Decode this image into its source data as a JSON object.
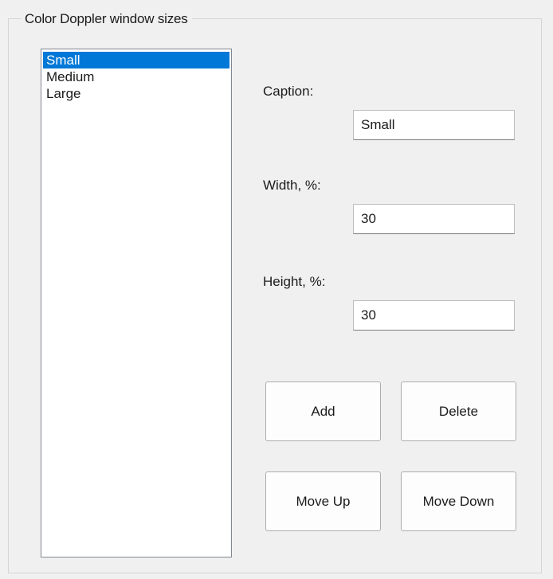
{
  "group": {
    "title": "Color Doppler window sizes"
  },
  "sizes_list": {
    "items": [
      "Small",
      "Medium",
      "Large"
    ],
    "selected_index": 0
  },
  "caption": {
    "label": "Caption:",
    "value": "Small"
  },
  "width": {
    "label": "Width, %:",
    "value": "30"
  },
  "height": {
    "label": "Height, %:",
    "value": "30"
  },
  "buttons": {
    "add": "Add",
    "delete": "Delete",
    "move_up": "Move Up",
    "move_down": "Move Down"
  },
  "colors": {
    "selection": "#0078d7",
    "window_bg": "#f0f0f0"
  }
}
